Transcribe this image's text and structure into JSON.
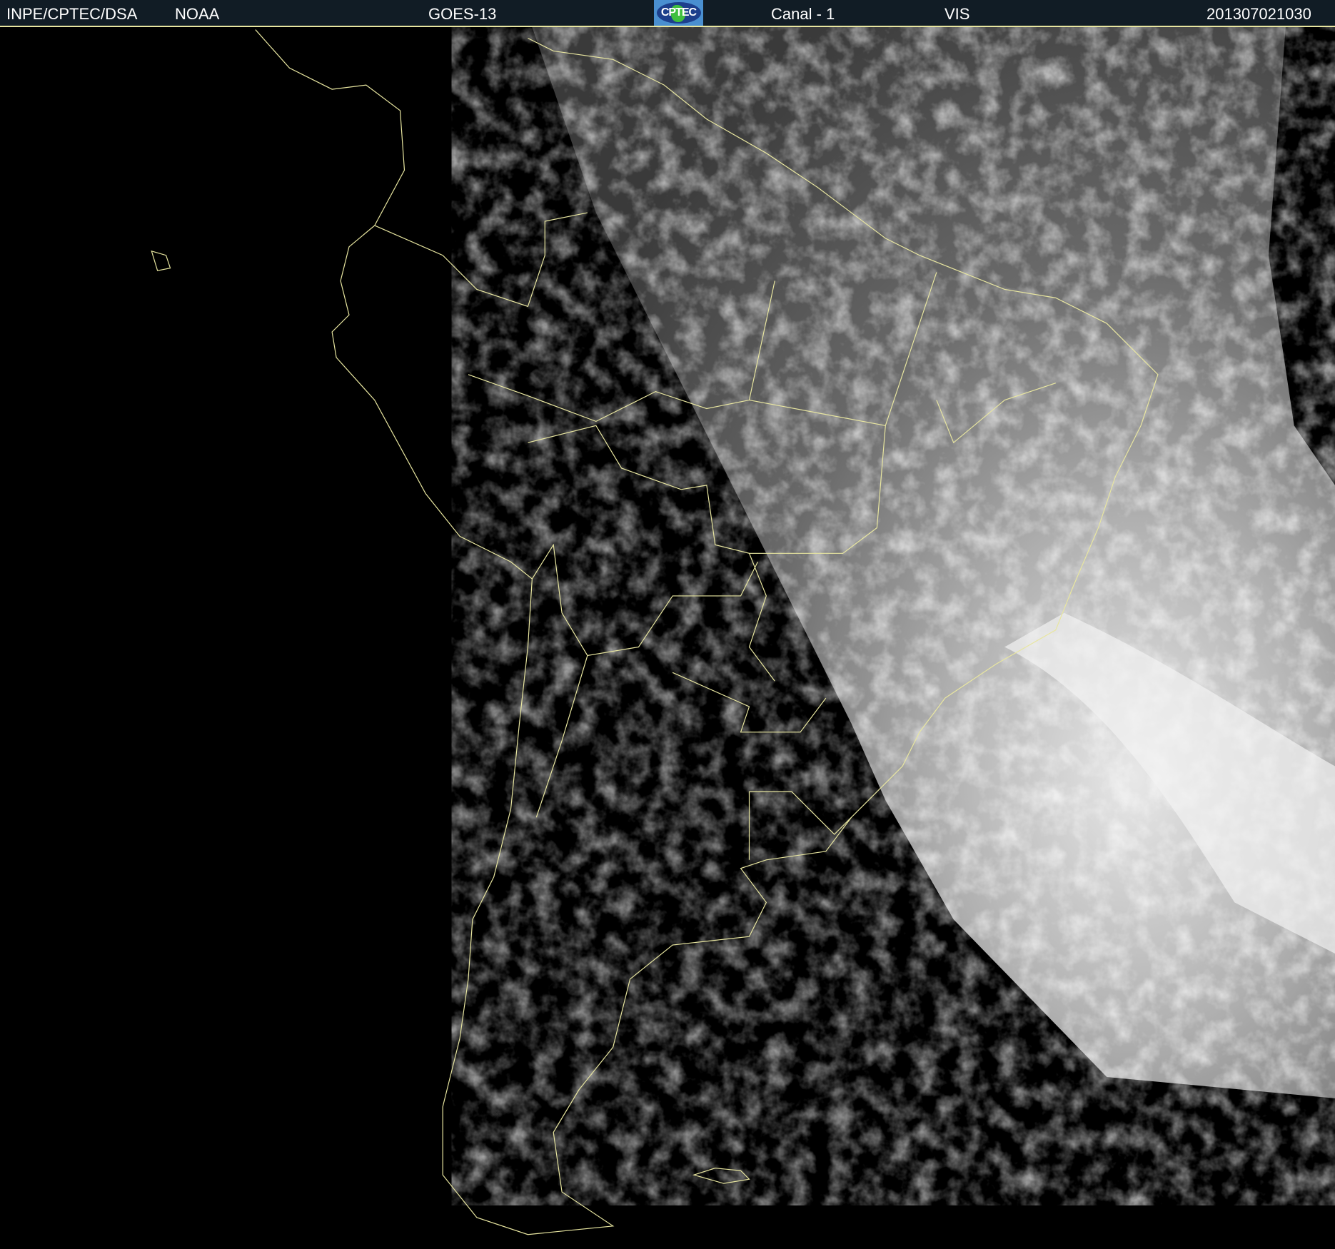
{
  "header": {
    "source": "INPE/CPTEC/DSA",
    "agency": "NOAA",
    "satellite": "GOES-13",
    "logo_text": "CPTEC",
    "channel": "Canal - 1",
    "band": "VIS",
    "timestamp": "201307021030"
  },
  "colors": {
    "header_bg": "#111c25",
    "outline": "#e8e6a0",
    "background": "#000000"
  }
}
